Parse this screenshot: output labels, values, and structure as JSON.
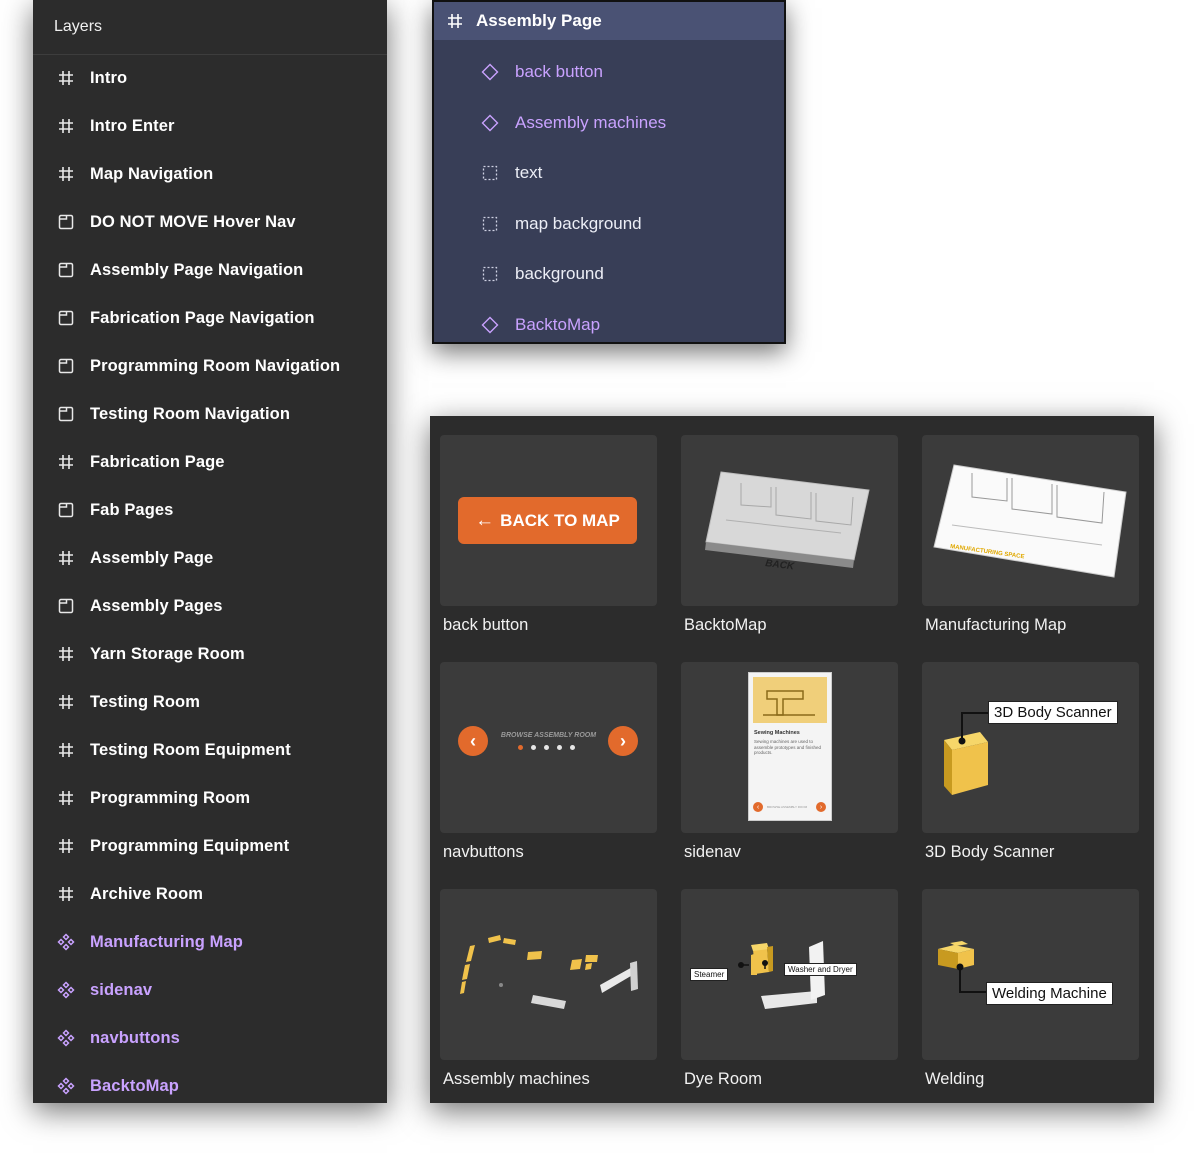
{
  "layers": {
    "title": "Layers",
    "items": [
      {
        "label": "Intro",
        "icon": "frame-icon",
        "type": "frame"
      },
      {
        "label": "Intro Enter",
        "icon": "frame-icon",
        "type": "frame"
      },
      {
        "label": "Map Navigation",
        "icon": "frame-icon",
        "type": "frame"
      },
      {
        "label": "DO NOT MOVE Hover Nav",
        "icon": "section-icon",
        "type": "section"
      },
      {
        "label": "Assembly Page Navigation",
        "icon": "section-icon",
        "type": "section"
      },
      {
        "label": "Fabrication Page Navigation",
        "icon": "section-icon",
        "type": "section"
      },
      {
        "label": "Programming Room Navigation",
        "icon": "section-icon",
        "type": "section"
      },
      {
        "label": "Testing Room Navigation",
        "icon": "section-icon",
        "type": "section"
      },
      {
        "label": "Fabrication Page",
        "icon": "frame-icon",
        "type": "frame"
      },
      {
        "label": "Fab Pages",
        "icon": "section-icon",
        "type": "section"
      },
      {
        "label": "Assembly Page",
        "icon": "frame-icon",
        "type": "frame"
      },
      {
        "label": "Assembly Pages",
        "icon": "section-icon",
        "type": "section"
      },
      {
        "label": "Yarn Storage Room",
        "icon": "frame-icon",
        "type": "frame"
      },
      {
        "label": "Testing Room",
        "icon": "frame-icon",
        "type": "frame"
      },
      {
        "label": "Testing Room Equipment",
        "icon": "frame-icon",
        "type": "frame"
      },
      {
        "label": "Programming Room",
        "icon": "frame-icon",
        "type": "frame"
      },
      {
        "label": "Programming Equipment",
        "icon": "frame-icon",
        "type": "frame"
      },
      {
        "label": "Archive Room",
        "icon": "frame-icon",
        "type": "frame"
      },
      {
        "label": "Manufacturing Map",
        "icon": "component-set-icon",
        "type": "component"
      },
      {
        "label": "sidenav",
        "icon": "component-set-icon",
        "type": "component"
      },
      {
        "label": "navbuttons",
        "icon": "component-set-icon",
        "type": "component"
      },
      {
        "label": "BacktoMap",
        "icon": "component-set-icon",
        "type": "component"
      }
    ]
  },
  "assembly": {
    "title": "Assembly Page",
    "items": [
      {
        "label": "back button",
        "icon": "instance-icon",
        "type": "component"
      },
      {
        "label": "Assembly machines",
        "icon": "instance-icon",
        "type": "component"
      },
      {
        "label": "text",
        "icon": "group-icon",
        "type": "group"
      },
      {
        "label": "map background",
        "icon": "group-icon",
        "type": "group"
      },
      {
        "label": "background",
        "icon": "group-icon",
        "type": "group"
      },
      {
        "label": "BacktoMap",
        "icon": "instance-icon",
        "type": "component"
      }
    ]
  },
  "assets": {
    "cards": [
      {
        "name": "back button",
        "button_text": "BACK TO MAP"
      },
      {
        "name": "BacktoMap",
        "map_label": "BACK"
      },
      {
        "name": "Manufacturing Map",
        "map_label": "MANUFACTURING SPACE"
      },
      {
        "name": "navbuttons",
        "nav_text": "BROWSE ASSEMBLY ROOM"
      },
      {
        "name": "sidenav",
        "title": "Sewing Machines",
        "body": "Sewing machines are used to assemble prototypes and finished products.",
        "footer": "BROWSE ASSEMBLY ROOM"
      },
      {
        "name": "3D Body Scanner",
        "callout": "3D Body Scanner"
      },
      {
        "name": "Assembly machines"
      },
      {
        "name": "Dye Room",
        "callout1": "Steamer",
        "callout2": "Washer and Dryer"
      },
      {
        "name": "Welding",
        "callout": "Welding Machine"
      }
    ]
  },
  "colors": {
    "panel": "#2c2c2c",
    "component_purple": "#c9a2ff",
    "selection_header": "#4a5274",
    "accent_orange": "#e26a2c",
    "scanner_yellow": "#f0c24b"
  }
}
